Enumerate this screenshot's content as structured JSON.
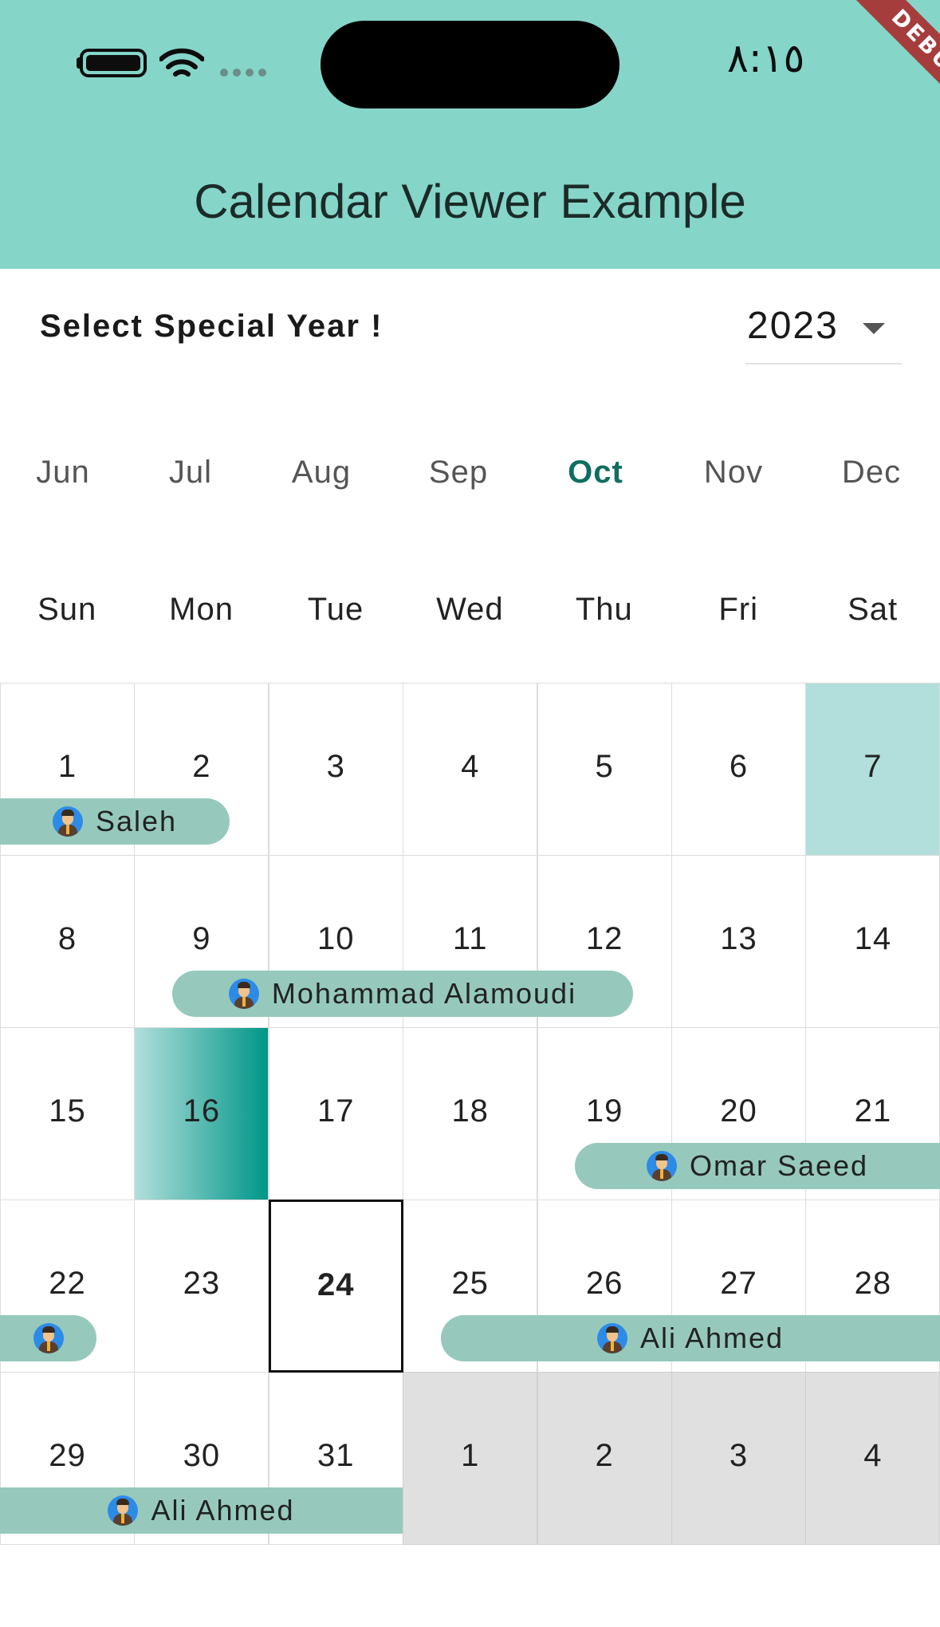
{
  "status_bar": {
    "time": "٨:١٥",
    "debug_banner": "DEBUG"
  },
  "app_bar": {
    "title": "Calendar Viewer Example"
  },
  "year_selector": {
    "label": "Select Special Year !",
    "selected_year": "2023"
  },
  "months": [
    {
      "label": "Jun",
      "active": false
    },
    {
      "label": "Jul",
      "active": false
    },
    {
      "label": "Aug",
      "active": false
    },
    {
      "label": "Sep",
      "active": false
    },
    {
      "label": "Oct",
      "active": true
    },
    {
      "label": "Nov",
      "active": false
    },
    {
      "label": "Dec",
      "active": false
    }
  ],
  "weekdays": [
    "Sun",
    "Mon",
    "Tue",
    "Wed",
    "Thu",
    "Fri",
    "Sat"
  ],
  "weeks": [
    [
      "1",
      "2",
      "3",
      "4",
      "5",
      "6",
      "7"
    ],
    [
      "8",
      "9",
      "10",
      "11",
      "12",
      "13",
      "14"
    ],
    [
      "15",
      "16",
      "17",
      "18",
      "19",
      "20",
      "21"
    ],
    [
      "22",
      "23",
      "24",
      "25",
      "26",
      "27",
      "28"
    ],
    [
      "29",
      "30",
      "31",
      "1",
      "2",
      "3",
      "4"
    ]
  ],
  "today": "24",
  "events": [
    {
      "label": "Saleh"
    },
    {
      "label": "Mohammad Alamoudi"
    },
    {
      "label": "Omar Saeed"
    },
    {
      "label": ""
    },
    {
      "label": "Ali Ahmed"
    },
    {
      "label": "Ali Ahmed"
    }
  ],
  "colors": {
    "app_bar": "#85d5c9",
    "selected_month": "#0f6e5f",
    "event_chip": "#96c9bc",
    "weekend_highlight": "#b2dfdb",
    "range_gradient_end": "#009688",
    "outside_month": "#e0e0e0"
  },
  "icons": {
    "status_bar": [
      "battery-icon",
      "wifi-icon",
      "cellular-signal-icon"
    ],
    "dropdown": "caret-down-icon",
    "event_avatar": "user-avatar-icon"
  }
}
